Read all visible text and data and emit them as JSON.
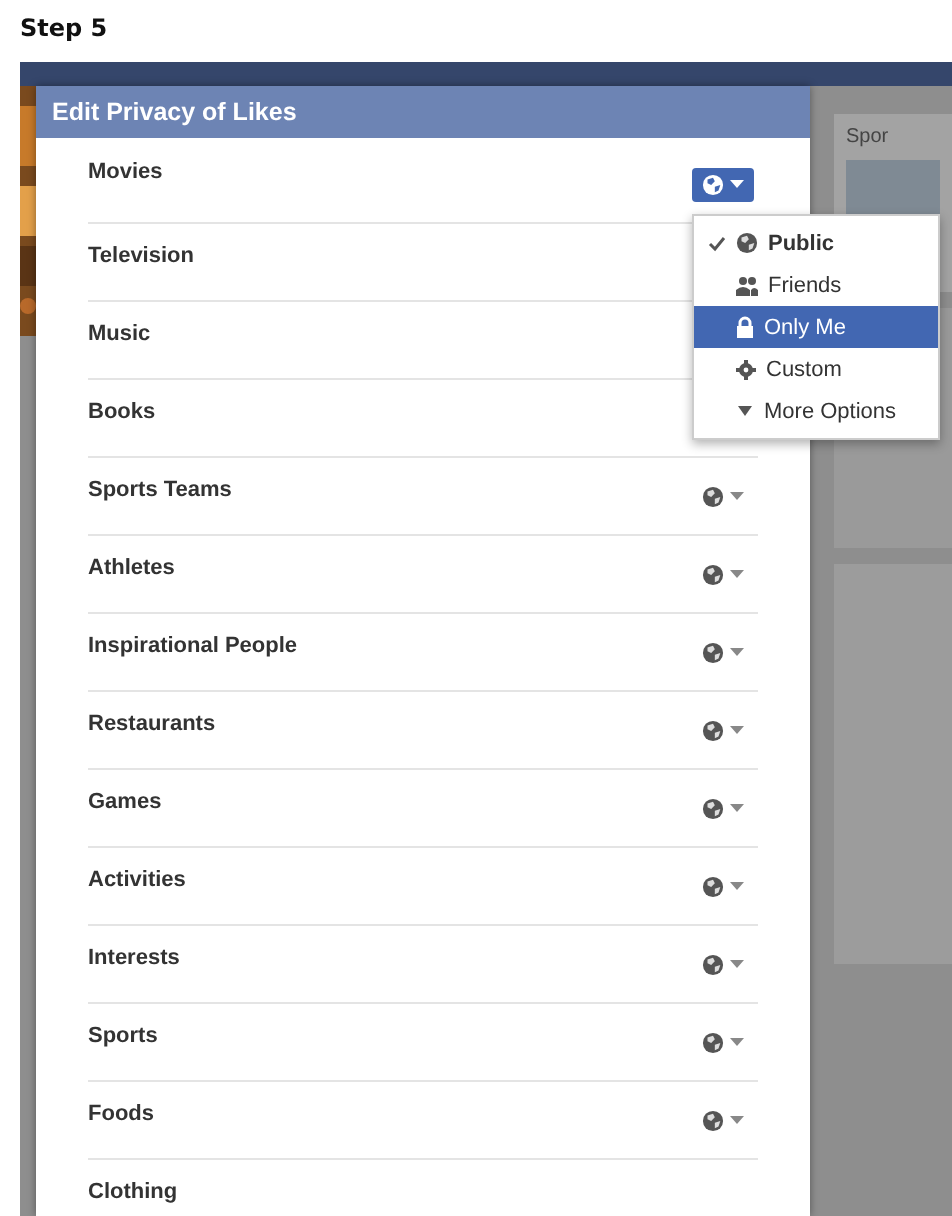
{
  "step_title": "Step 5",
  "background": {
    "side_heading": "Spor"
  },
  "dialog": {
    "title": "Edit Privacy of Likes",
    "rows": [
      {
        "label": "Movies",
        "kind": "selector-open"
      },
      {
        "label": "Television",
        "kind": "covered"
      },
      {
        "label": "Music",
        "kind": "covered"
      },
      {
        "label": "Books",
        "kind": "covered"
      },
      {
        "label": "Sports Teams",
        "kind": "selector"
      },
      {
        "label": "Athletes",
        "kind": "selector"
      },
      {
        "label": "Inspirational People",
        "kind": "selector"
      },
      {
        "label": "Restaurants",
        "kind": "selector"
      },
      {
        "label": "Games",
        "kind": "selector"
      },
      {
        "label": "Activities",
        "kind": "selector"
      },
      {
        "label": "Interests",
        "kind": "selector"
      },
      {
        "label": "Sports",
        "kind": "selector"
      },
      {
        "label": "Foods",
        "kind": "selector"
      },
      {
        "label": "Clothing",
        "kind": "none"
      }
    ],
    "menu": [
      {
        "label": "Public",
        "kind": "globe",
        "checked": true,
        "selected": false
      },
      {
        "label": "Friends",
        "kind": "people",
        "checked": false,
        "selected": false
      },
      {
        "label": "Only Me",
        "kind": "lock",
        "checked": false,
        "selected": true
      },
      {
        "label": "Custom",
        "kind": "gear",
        "checked": false,
        "selected": false
      },
      {
        "label": "More Options",
        "kind": "caret",
        "checked": false,
        "selected": false
      }
    ]
  }
}
